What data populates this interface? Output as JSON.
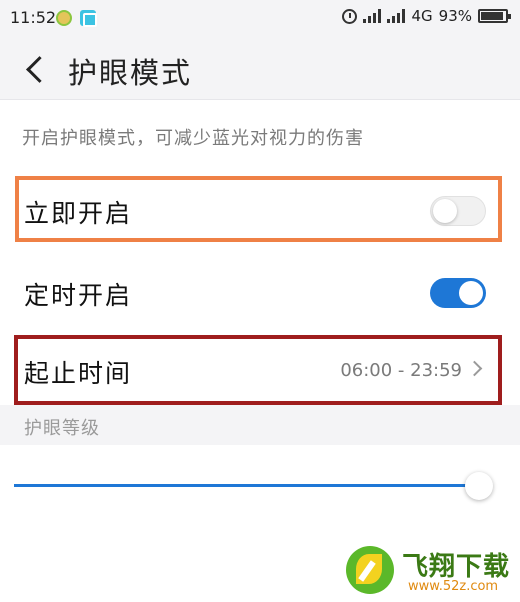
{
  "status_bar": {
    "time": "11:52",
    "network": "4G",
    "battery": "93%",
    "battery_level": 0.93,
    "icons": [
      "alarm-icon",
      "signal-icon",
      "signal-icon",
      "battery-icon"
    ]
  },
  "header": {
    "back_icon": "chevron-left-icon",
    "title": "护眼模式"
  },
  "description": "开启护眼模式，可减少蓝光对视力的伤害",
  "settings": {
    "immediate": {
      "label": "立即开启",
      "enabled": false
    },
    "scheduled": {
      "label": "定时开启",
      "enabled": true
    },
    "time_range": {
      "label": "起止时间",
      "value": "06:00 - 23:59"
    }
  },
  "eye_level": {
    "label": "护眼等级",
    "value": 0.96
  },
  "watermark": {
    "name": "飞翔下载",
    "url": "www.52z.com"
  },
  "colors": {
    "accent": "#1e77d6",
    "highlight_orange": "#ef8146",
    "highlight_red": "#9f1d1d"
  }
}
